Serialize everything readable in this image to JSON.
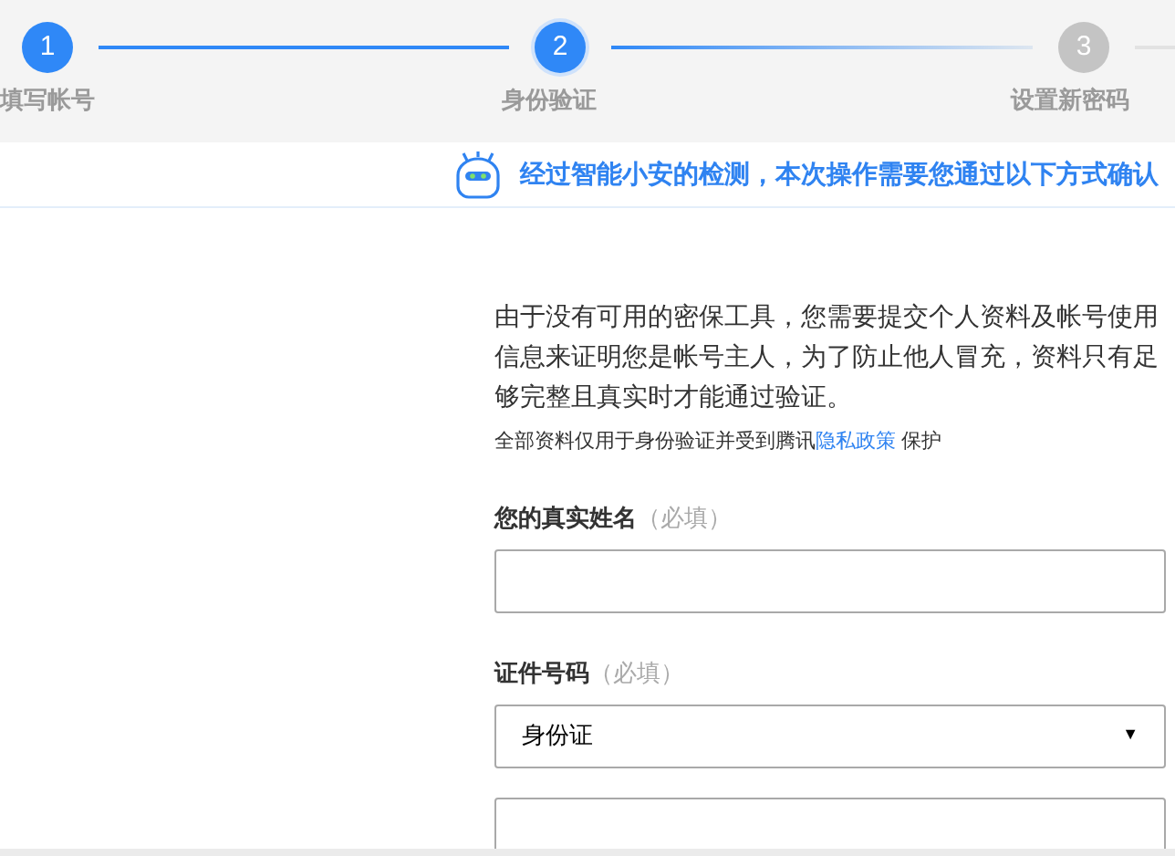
{
  "steps": [
    {
      "number": "1",
      "label": "填写帐号",
      "reached": true,
      "selected": false
    },
    {
      "number": "2",
      "label": "身份验证",
      "reached": true,
      "selected": true
    },
    {
      "number": "3",
      "label": "设置新密码",
      "reached": false,
      "selected": false
    }
  ],
  "notice": "经过智能小安的检测，本次操作需要您通过以下方式确认",
  "intro": "由于没有可用的密保工具，您需要提交个人资料及帐号使用信息来证明您是帐号主人，为了防止他人冒充，资料只有足够完整且真实时才能通过验证。",
  "privacy": {
    "before": "全部资料仅用于身份验证并受到腾讯",
    "link": "隐私政策",
    "after": "保护"
  },
  "fields": [
    {
      "kind": "text",
      "label": "您的真实姓名",
      "hint": "（必填）"
    },
    {
      "kind": "select",
      "label": "证件号码",
      "hint": "（必填）",
      "value": "身份证",
      "arrow": "▼"
    },
    {
      "kind": "text"
    }
  ]
}
